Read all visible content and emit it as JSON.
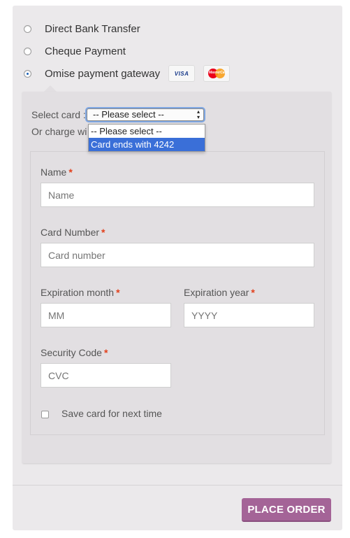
{
  "payment_methods": [
    {
      "label": "Direct Bank Transfer",
      "checked": false
    },
    {
      "label": "Cheque Payment",
      "checked": false
    },
    {
      "label": "Omise payment gateway",
      "checked": true
    }
  ],
  "card_logos": {
    "visa": "VISA",
    "mastercard": "MasterCard"
  },
  "card_select": {
    "label": "Select card :",
    "value": "-- Please select --",
    "options": [
      "-- Please select --",
      "Card ends with 4242"
    ],
    "highlighted_index": 1,
    "charge_text": "Or charge wi"
  },
  "form": {
    "name": {
      "label": "Name",
      "placeholder": "Name"
    },
    "card_number": {
      "label": "Card Number",
      "placeholder": "Card number"
    },
    "exp_month": {
      "label": "Expiration month",
      "placeholder": "MM"
    },
    "exp_year": {
      "label": "Expiration year",
      "placeholder": "YYYY"
    },
    "cvc": {
      "label": "Security Code",
      "placeholder": "CVC"
    },
    "required_mark": "*",
    "save_card": {
      "label": "Save card for next time",
      "checked": false
    }
  },
  "place_order": "PLACE ORDER",
  "colors": {
    "accent": "#a46497",
    "required": "#e2401c",
    "selection": "#3a6fd8"
  }
}
